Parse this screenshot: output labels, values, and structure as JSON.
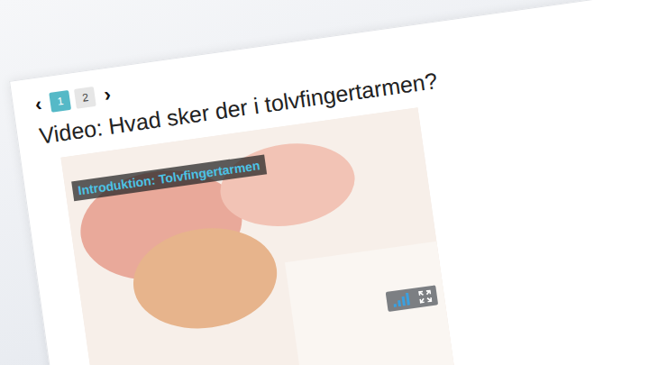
{
  "pagination": {
    "prev": "‹",
    "next": "›",
    "pages": [
      {
        "label": "1",
        "selected": true
      },
      {
        "label": "2",
        "selected": false
      }
    ]
  },
  "title": "Video: Hvad sker der i tolvfingertarmen?",
  "video": {
    "title": "Introduktion: Tolvfingertarmen",
    "volume": {
      "level": 1
    }
  }
}
